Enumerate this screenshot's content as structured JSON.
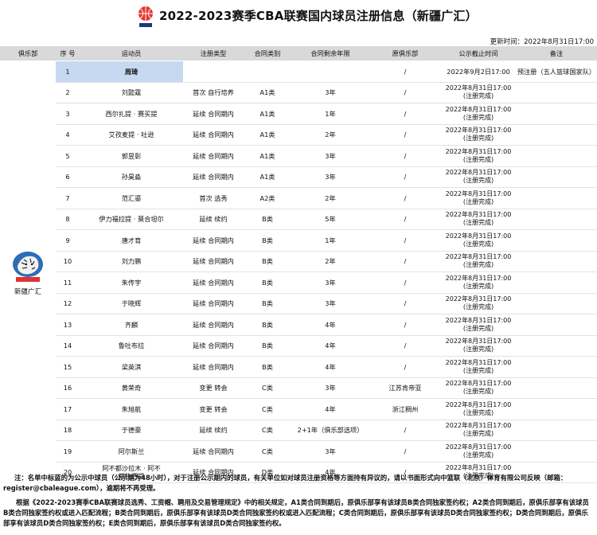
{
  "header": {
    "title": "2022-2023赛季CBA联赛国内球员注册信息（新疆广汇）",
    "updated": "更新时间：2022年8月31日17:00"
  },
  "columns": [
    "俱乐部",
    "序 号",
    "运动员",
    "注册类型",
    "合同类别",
    "合同剩余年限",
    "原俱乐部",
    "公示截止时间",
    "备注"
  ],
  "club": {
    "name": "新疆广汇"
  },
  "colors": {
    "header_bg": "#d9d9d9",
    "highlight": "#c6d9f1"
  },
  "rows": [
    {
      "no": "1",
      "player": "周琦",
      "reg": "",
      "cat": "",
      "years": "",
      "orig": "/",
      "deadline": "2022年9月2日17:00",
      "remark": "预注册（五人篮球国家队）",
      "highlight": true
    },
    {
      "no": "2",
      "player": "刘懿霆",
      "reg": "首次  自行培养",
      "cat": "A1类",
      "years": "3年",
      "orig": "/",
      "deadline": "2022年8月31日17:00\n(注册完成)",
      "remark": ""
    },
    {
      "no": "3",
      "player": "西尔扎提 · 赛买提",
      "reg": "延续  合同期内",
      "cat": "A1类",
      "years": "1年",
      "orig": "/",
      "deadline": "2022年8月31日17:00\n(注册完成)",
      "remark": ""
    },
    {
      "no": "4",
      "player": "艾孜麦提 · 吐逊",
      "reg": "延续  合同期内",
      "cat": "A1类",
      "years": "2年",
      "orig": "/",
      "deadline": "2022年8月31日17:00\n(注册完成)",
      "remark": ""
    },
    {
      "no": "5",
      "player": "郭昱彰",
      "reg": "延续  合同期内",
      "cat": "A1类",
      "years": "3年",
      "orig": "/",
      "deadline": "2022年8月31日17:00\n(注册完成)",
      "remark": ""
    },
    {
      "no": "6",
      "player": "孙昊淼",
      "reg": "延续  合同期内",
      "cat": "A1类",
      "years": "3年",
      "orig": "/",
      "deadline": "2022年8月31日17:00\n(注册完成)",
      "remark": ""
    },
    {
      "no": "7",
      "player": "范汇鎏",
      "reg": "首次    选秀",
      "cat": "A2类",
      "years": "2年",
      "orig": "/",
      "deadline": "2022年8月31日17:00\n(注册完成)",
      "remark": ""
    },
    {
      "no": "8",
      "player": "伊力福拉提 · 莫合坦尔",
      "reg": "延续    续约",
      "cat": "B类",
      "years": "5年",
      "orig": "/",
      "deadline": "2022年8月31日17:00\n(注册完成)",
      "remark": ""
    },
    {
      "no": "9",
      "player": "唐才育",
      "reg": "延续  合同期内",
      "cat": "B类",
      "years": "1年",
      "orig": "/",
      "deadline": "2022年8月31日17:00\n(注册完成)",
      "remark": ""
    },
    {
      "no": "10",
      "player": "刘力鹏",
      "reg": "延续  合同期内",
      "cat": "B类",
      "years": "2年",
      "orig": "/",
      "deadline": "2022年8月31日17:00\n(注册完成)",
      "remark": ""
    },
    {
      "no": "11",
      "player": "朱传宇",
      "reg": "延续  合同期内",
      "cat": "B类",
      "years": "3年",
      "orig": "/",
      "deadline": "2022年8月31日17:00\n(注册完成)",
      "remark": ""
    },
    {
      "no": "12",
      "player": "于晓辉",
      "reg": "延续  合同期内",
      "cat": "B类",
      "years": "3年",
      "orig": "/",
      "deadline": "2022年8月31日17:00\n(注册完成)",
      "remark": ""
    },
    {
      "no": "13",
      "player": "齐麟",
      "reg": "延续  合同期内",
      "cat": "B类",
      "years": "4年",
      "orig": "/",
      "deadline": "2022年8月31日17:00\n(注册完成)",
      "remark": ""
    },
    {
      "no": "14",
      "player": "鲁吐布拉",
      "reg": "延续  合同期内",
      "cat": "B类",
      "years": "4年",
      "orig": "/",
      "deadline": "2022年8月31日17:00\n(注册完成)",
      "remark": ""
    },
    {
      "no": "15",
      "player": "梁英淇",
      "reg": "延续  合同期内",
      "cat": "B类",
      "years": "4年",
      "orig": "/",
      "deadline": "2022年8月31日17:00\n(注册完成)",
      "remark": ""
    },
    {
      "no": "16",
      "player": "黄荣奇",
      "reg": "变更    转会",
      "cat": "C类",
      "years": "3年",
      "orig": "江苏肯帝亚",
      "deadline": "2022年8月31日17:00\n(注册完成)",
      "remark": ""
    },
    {
      "no": "17",
      "player": "朱旭航",
      "reg": "变更    转会",
      "cat": "C类",
      "years": "4年",
      "orig": "浙江稠州",
      "deadline": "2022年8月31日17:00\n(注册完成)",
      "remark": ""
    },
    {
      "no": "18",
      "player": "于德豪",
      "reg": "延续    续约",
      "cat": "C类",
      "years": "2+1年（俱乐部选项）",
      "orig": "/",
      "deadline": "2022年8月31日17:00\n(注册完成)",
      "remark": ""
    },
    {
      "no": "19",
      "player": "阿尔斯兰",
      "reg": "延续  合同期内",
      "cat": "C类",
      "years": "3年",
      "orig": "/",
      "deadline": "2022年8月31日17:00\n(注册完成)",
      "remark": ""
    },
    {
      "no": "20",
      "player": "阿不都沙拉木 · 阿不\n都热西提",
      "reg": "延续  合同期内",
      "cat": "D类",
      "years": "4年",
      "orig": "/",
      "deadline": "2022年8月31日17:00\n(注册完成)",
      "remark": "",
      "two_line": true
    }
  ],
  "notes": {
    "n1": "注：名单中标蓝的为公示中球员（公示期为48小时），对于注册公示期内的球员，有关单位如对球员注册资格等方面持有异议的，请以书面形式向中篮联（北京）体育有限公司反映（邮箱：register@cbaleague.com），逾期将不再受理。",
    "n2": "根据《2022-2023赛季CBA联赛球员选秀、工资帽、聘用及交易管理规定》中的相关规定，A1类合同到期后，原俱乐部享有该球员B类合同独家签约权；A2类合同到期后，原俱乐部享有该球员B类合同独家签约权或进入匹配流程；B类合同到期后，原俱乐部享有该球员D类合同独家签约权或进入匹配流程；C类合同到期后，原俱乐部享有该球员D类合同独家签约权；D类合同到期后，原俱乐部享有该球员D类合同独家签约权；E类合同到期后，原俱乐部享有该球员D类合同独家签约权。"
  }
}
